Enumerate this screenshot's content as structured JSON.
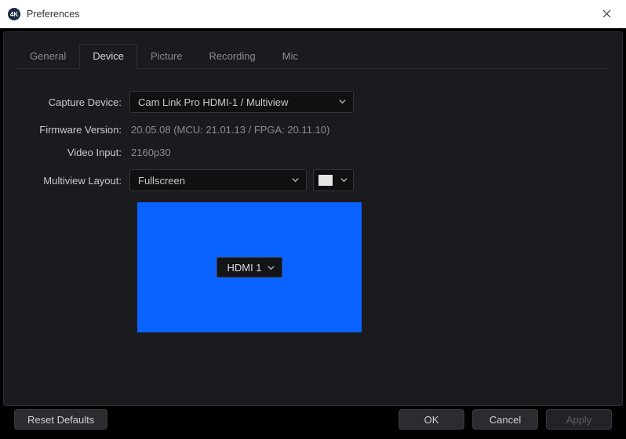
{
  "window": {
    "title": "Preferences",
    "app_icon_text": "4K"
  },
  "tabs": [
    {
      "label": "General",
      "active": false
    },
    {
      "label": "Device",
      "active": true
    },
    {
      "label": "Picture",
      "active": false
    },
    {
      "label": "Recording",
      "active": false
    },
    {
      "label": "Mic",
      "active": false
    }
  ],
  "device": {
    "capture_device_label": "Capture Device:",
    "capture_device_value": "Cam Link Pro HDMI-1 / Multiview",
    "firmware_label": "Firmware Version:",
    "firmware_value": "20.05.08 (MCU: 21.01.13 / FPGA: 20.11.10)",
    "video_input_label": "Video Input:",
    "video_input_value": "2160p30",
    "multiview_layout_label": "Multiview Layout:",
    "multiview_layout_value": "Fullscreen",
    "multiview_color": "#e6e6e6",
    "preview_color": "#0a62ff",
    "preview_slot_label": "HDMI 1"
  },
  "footer": {
    "reset_label": "Reset Defaults",
    "ok_label": "OK",
    "cancel_label": "Cancel",
    "apply_label": "Apply",
    "apply_enabled": false
  }
}
